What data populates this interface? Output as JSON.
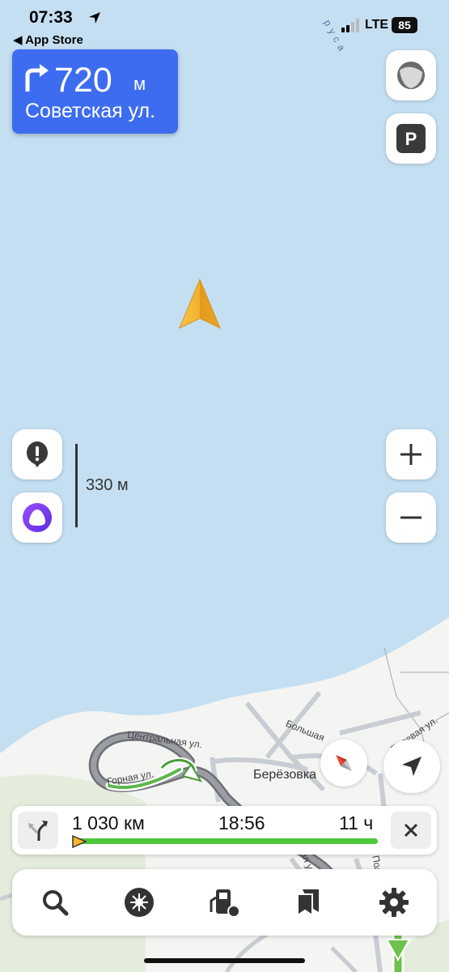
{
  "status_bar": {
    "time": "07:33",
    "back_label": "◀ App Store",
    "network": "LTE",
    "battery": "85"
  },
  "map": {
    "river_label": "р у с а",
    "scale_label": "330 м",
    "labels": {
      "street_central": "Центральная ул.",
      "street_gornaya": "Горная ул.",
      "street_bolshaya": "Большая",
      "street_right": "Полевая ул.",
      "village": "Берёзовка",
      "street_bottom1": "ая ул.",
      "street_bottom2": "Пол"
    }
  },
  "maneuver": {
    "distance": "720",
    "unit": "м",
    "street": "Советская ул."
  },
  "route": {
    "distance": "1 030 км",
    "arrival": "18:56",
    "duration": "11 ч",
    "progress": 0.0
  },
  "toolbar": {
    "items": [
      "search-icon",
      "discovery-icon",
      "fuel-icon",
      "bookmarks-icon",
      "settings-icon"
    ]
  },
  "colors": {
    "water": "#c5dff2",
    "land": "#f4f4f2",
    "maneuver_bg": "#3d6cf0",
    "route_green": "#4fc73f",
    "cursor": "#f5b82e"
  }
}
